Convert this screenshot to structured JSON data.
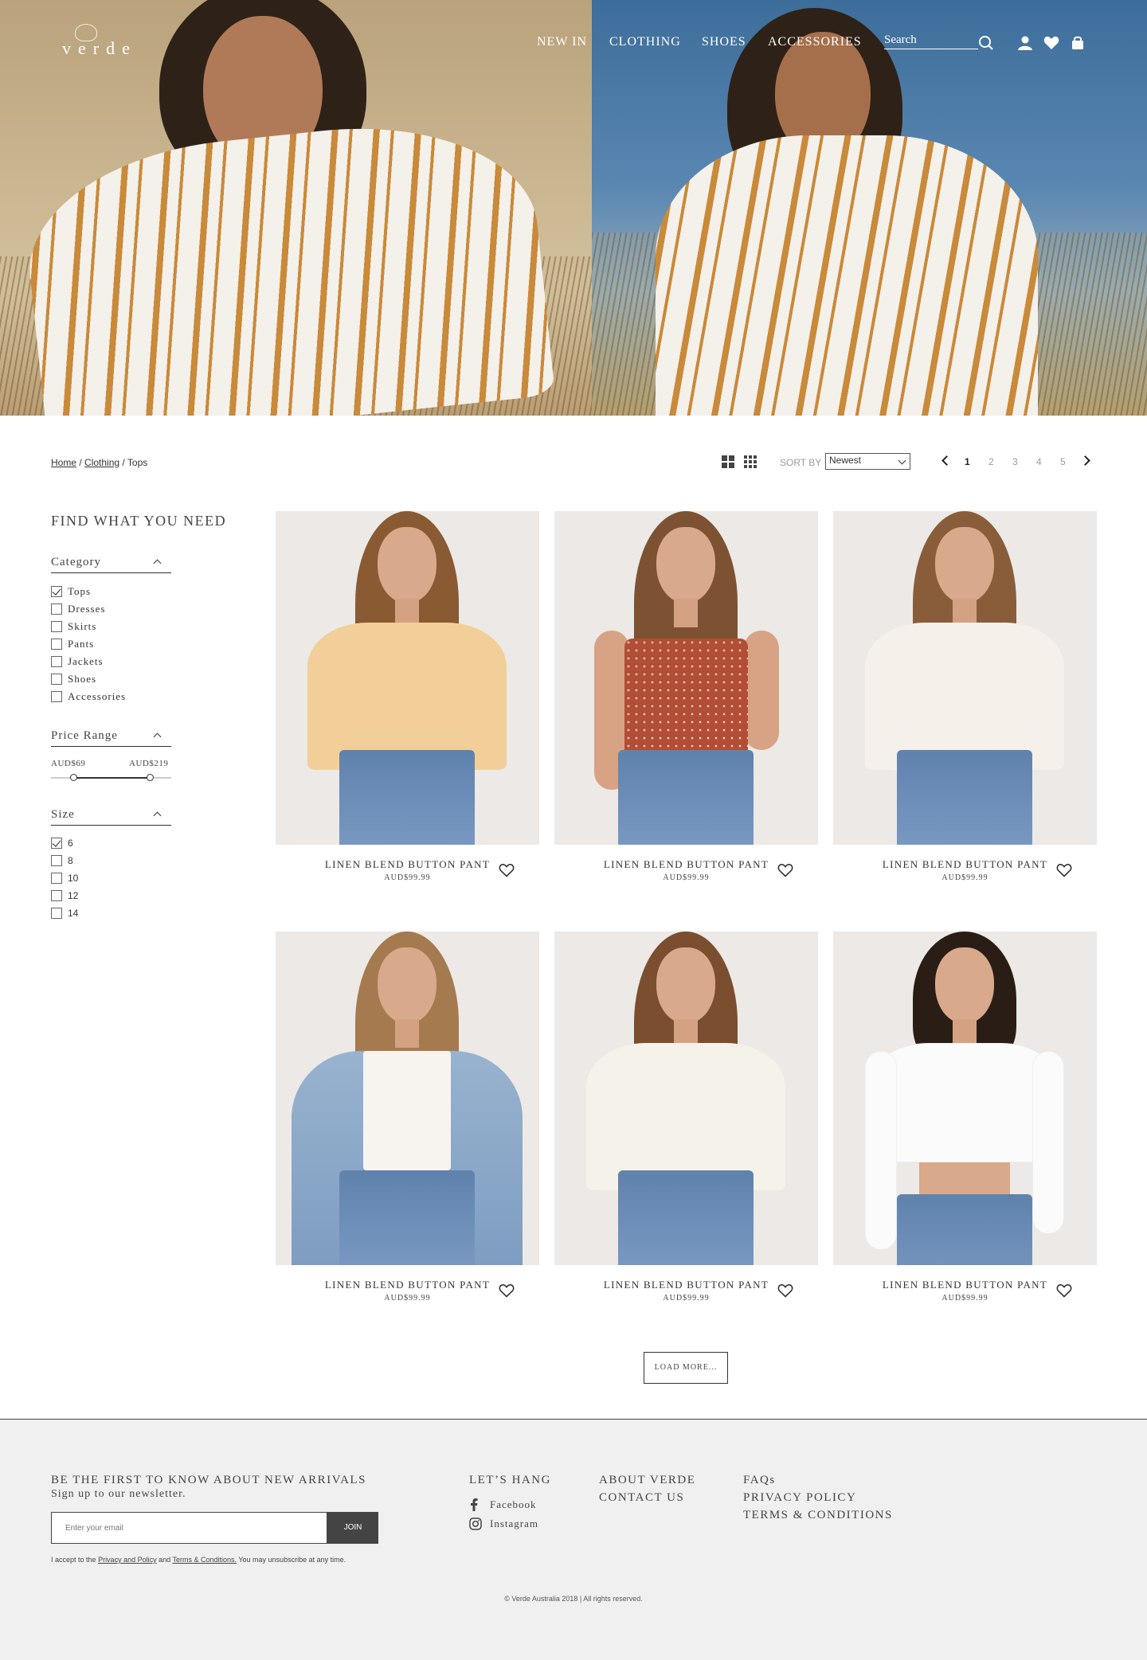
{
  "brand": {
    "logo_text": "verde"
  },
  "nav": {
    "links": [
      "NEW IN",
      "CLOTHING",
      "SHOES",
      "ACCESSORIES"
    ],
    "search_placeholder": "Search",
    "icons": [
      "search-icon",
      "user-icon",
      "heart-icon",
      "bag-icon"
    ]
  },
  "breadcrumb": {
    "home": "Home",
    "separator": "/",
    "clothing": "Clothing",
    "current": "Tops"
  },
  "toolbar": {
    "view_icons": [
      "grid-2-icon",
      "grid-3-icon"
    ],
    "sort_label": "SORT BY",
    "sort_value": "Newest",
    "pages": [
      "1",
      "2",
      "3",
      "4",
      "5"
    ],
    "active_page": "1"
  },
  "sidebar": {
    "title": "FIND WHAT YOU NEED",
    "category": {
      "title": "Category",
      "items": [
        {
          "label": "Tops",
          "checked": true
        },
        {
          "label": "Dresses",
          "checked": false
        },
        {
          "label": "Skirts",
          "checked": false
        },
        {
          "label": "Pants",
          "checked": false
        },
        {
          "label": "Jackets",
          "checked": false
        },
        {
          "label": "Shoes",
          "checked": false
        },
        {
          "label": "Accessories",
          "checked": false
        }
      ]
    },
    "price": {
      "title": "Price Range",
      "min_label": "AUD$69",
      "max_label": "AUD$219"
    },
    "size": {
      "title": "Size",
      "items": [
        {
          "label": "6",
          "checked": true
        },
        {
          "label": "8",
          "checked": false
        },
        {
          "label": "10",
          "checked": false
        },
        {
          "label": "12",
          "checked": false
        },
        {
          "label": "14",
          "checked": false
        }
      ]
    }
  },
  "products": [
    {
      "name": "LINEN BLEND BUTTON PANT",
      "price": "AUD$99.99"
    },
    {
      "name": "LINEN BLEND BUTTON PANT",
      "price": "AUD$99.99"
    },
    {
      "name": "LINEN BLEND BUTTON PANT",
      "price": "AUD$99.99"
    },
    {
      "name": "LINEN BLEND BUTTON PANT",
      "price": "AUD$99.99"
    },
    {
      "name": "LINEN BLEND BUTTON PANT",
      "price": "AUD$99.99"
    },
    {
      "name": "LINEN BLEND BUTTON PANT",
      "price": "AUD$99.99"
    }
  ],
  "load_more": "LOAD MORE...",
  "footer": {
    "newsletter_title": "BE THE FIRST TO KNOW ABOUT NEW ARRIVALS",
    "newsletter_sub": "Sign up to our newsletter.",
    "email_placeholder": "Enter your email",
    "join_label": "JOIN",
    "consent_prefix": "I accept to the",
    "consent_privacy": "Privacy and Policy",
    "consent_and": "and",
    "consent_terms": "Terms & Conditions.",
    "consent_suffix": "You may unsubscribe at any time.",
    "social_title": "LET’S HANG",
    "social": [
      "Facebook",
      "Instagram"
    ],
    "links_col1": [
      "ABOUT VERDE",
      "CONTACT US"
    ],
    "links_col2": [
      "FAQs",
      "PRIVACY POLICY",
      "TERMS & CONDITIONS"
    ],
    "copyright": "© Verde Australia 2018  |   All rights reserved."
  },
  "colors": {
    "footer_bg": "#f0f0f0",
    "button_dark": "#444444",
    "stripe": "#c98a3a"
  }
}
